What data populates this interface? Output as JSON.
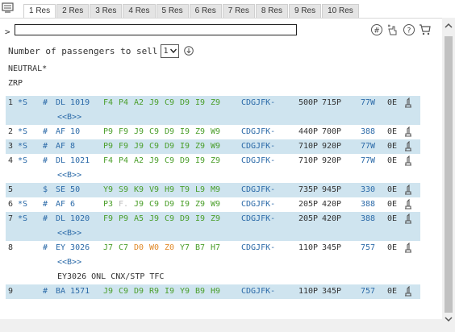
{
  "tabs": [
    "1 Res",
    "2 Res",
    "3 Res",
    "4 Res",
    "5 Res",
    "6 Res",
    "7 Res",
    "8 Res",
    "9 Res",
    "10 Res"
  ],
  "command": {
    "prompt": ">",
    "value": ""
  },
  "toolbar_icons": [
    "hash-icon",
    "hand-point-icon",
    "help-icon",
    "cart-icon"
  ],
  "passengers": {
    "label": "Number of passengers to sell",
    "value": "1"
  },
  "header": {
    "mode": "NEUTRAL*",
    "airport": "ZRP"
  },
  "colors": {
    "shade": "#cfe4ef",
    "link": "#2b6aa8",
    "available_class": "#4a9e2a",
    "limited_class": "#e08a2a",
    "closed_class": "#bbbbbb"
  },
  "flights": [
    {
      "num": "1",
      "star": "*S",
      "pfx": "#",
      "flight": "DL 1019",
      "classes": [
        [
          "F4",
          "g"
        ],
        [
          "P4",
          "g"
        ],
        [
          "A2",
          "g"
        ],
        [
          "J9",
          "g"
        ],
        [
          "C9",
          "g"
        ],
        [
          "D9",
          "g"
        ],
        [
          "I9",
          "g"
        ],
        [
          "Z9",
          "g"
        ]
      ],
      "citypair": "CDGJFK-",
      "dep": "500P",
      "arr": "715P",
      "eqp": "77W",
      "stops": "0E",
      "shade": true,
      "more": "<<B>>"
    },
    {
      "num": "2",
      "star": "*S",
      "pfx": "#",
      "flight": "AF 10",
      "classes": [
        [
          "P9",
          "g"
        ],
        [
          "F9",
          "g"
        ],
        [
          "J9",
          "g"
        ],
        [
          "C9",
          "g"
        ],
        [
          "D9",
          "g"
        ],
        [
          "I9",
          "g"
        ],
        [
          "Z9",
          "g"
        ],
        [
          "W9",
          "g"
        ]
      ],
      "citypair": "CDGJFK-",
      "dep": "440P",
      "arr": "700P",
      "eqp": "388",
      "stops": "0E",
      "shade": false,
      "more": ""
    },
    {
      "num": "3",
      "star": "*S",
      "pfx": "#",
      "flight": "AF 8",
      "classes": [
        [
          "P9",
          "g"
        ],
        [
          "F9",
          "g"
        ],
        [
          "J9",
          "g"
        ],
        [
          "C9",
          "g"
        ],
        [
          "D9",
          "g"
        ],
        [
          "I9",
          "g"
        ],
        [
          "Z9",
          "g"
        ],
        [
          "W9",
          "g"
        ]
      ],
      "citypair": "CDGJFK-",
      "dep": "710P",
      "arr": "920P",
      "eqp": "77W",
      "stops": "0E",
      "shade": true,
      "more": ""
    },
    {
      "num": "4",
      "star": "*S",
      "pfx": "#",
      "flight": "DL 1021",
      "classes": [
        [
          "F4",
          "g"
        ],
        [
          "P4",
          "g"
        ],
        [
          "A2",
          "g"
        ],
        [
          "J9",
          "g"
        ],
        [
          "C9",
          "g"
        ],
        [
          "D9",
          "g"
        ],
        [
          "I9",
          "g"
        ],
        [
          "Z9",
          "g"
        ]
      ],
      "citypair": "CDGJFK-",
      "dep": "710P",
      "arr": "920P",
      "eqp": "77W",
      "stops": "0E",
      "shade": false,
      "more": "<<B>>"
    },
    {
      "num": "5",
      "star": "",
      "pfx": "$",
      "flight": "SE 50",
      "classes": [
        [
          "Y9",
          "g"
        ],
        [
          "S9",
          "g"
        ],
        [
          "K9",
          "g"
        ],
        [
          "V9",
          "g"
        ],
        [
          "H9",
          "g"
        ],
        [
          "T9",
          "g"
        ],
        [
          "L9",
          "g"
        ],
        [
          "M9",
          "g"
        ]
      ],
      "citypair": "CDGJFK-",
      "dep": "735P",
      "arr": "945P",
      "eqp": "330",
      "stops": "0E",
      "shade": true,
      "more": ""
    },
    {
      "num": "6",
      "star": "*S",
      "pfx": "#",
      "flight": "AF 6",
      "classes": [
        [
          "P3",
          "g"
        ],
        [
          "F.",
          "x"
        ],
        [
          "J9",
          "g"
        ],
        [
          "C9",
          "g"
        ],
        [
          "D9",
          "g"
        ],
        [
          "I9",
          "g"
        ],
        [
          "Z9",
          "g"
        ],
        [
          "W9",
          "g"
        ]
      ],
      "citypair": "CDGJFK-",
      "dep": "205P",
      "arr": "420P",
      "eqp": "388",
      "stops": "0E",
      "shade": false,
      "more": ""
    },
    {
      "num": "7",
      "star": "*S",
      "pfx": "#",
      "flight": "DL 1020",
      "classes": [
        [
          "F9",
          "g"
        ],
        [
          "P9",
          "g"
        ],
        [
          "A5",
          "g"
        ],
        [
          "J9",
          "g"
        ],
        [
          "C9",
          "g"
        ],
        [
          "D9",
          "g"
        ],
        [
          "I9",
          "g"
        ],
        [
          "Z9",
          "g"
        ]
      ],
      "citypair": "CDGJFK-",
      "dep": "205P",
      "arr": "420P",
      "eqp": "388",
      "stops": "0E",
      "shade": true,
      "more": "<<B>>"
    },
    {
      "num": "8",
      "star": "",
      "pfx": "#",
      "flight": "EY 3026",
      "classes": [
        [
          "J7",
          "g"
        ],
        [
          "C7",
          "g"
        ],
        [
          "D0",
          "o"
        ],
        [
          "W0",
          "o"
        ],
        [
          "Z0",
          "o"
        ],
        [
          "Y7",
          "g"
        ],
        [
          "B7",
          "g"
        ],
        [
          "H7",
          "g"
        ]
      ],
      "citypair": "CDGJFK-",
      "dep": "110P",
      "arr": "345P",
      "eqp": "757",
      "stops": "0E",
      "shade": false,
      "more": "<<B>>",
      "note": "EY3026 ONL CNX/STP TFC"
    },
    {
      "num": "9",
      "star": "",
      "pfx": "#",
      "flight": "BA 1571",
      "classes": [
        [
          "J9",
          "g"
        ],
        [
          "C9",
          "g"
        ],
        [
          "D9",
          "g"
        ],
        [
          "R9",
          "g"
        ],
        [
          "I9",
          "g"
        ],
        [
          "Y9",
          "g"
        ],
        [
          "B9",
          "g"
        ],
        [
          "H9",
          "g"
        ]
      ],
      "citypair": "CDGJFK-",
      "dep": "110P",
      "arr": "345P",
      "eqp": "757",
      "stops": "0E",
      "shade": true,
      "more": ""
    }
  ]
}
